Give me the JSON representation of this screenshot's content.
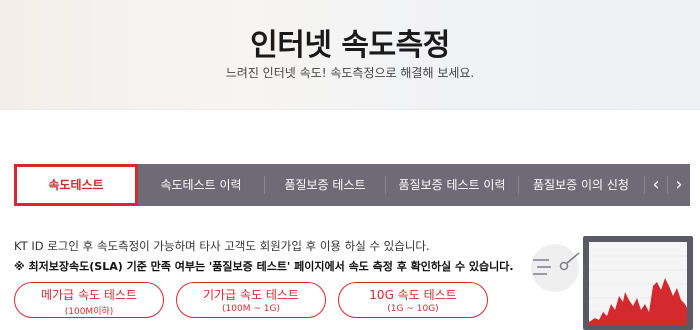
{
  "hero": {
    "title": "인터넷 속도측정",
    "subtitle": "느려진 인터넷 속도! 속도측정으로 해결해 보세요."
  },
  "tabs": [
    {
      "label": "속도테스트",
      "active": true
    },
    {
      "label": "속도테스트 이력",
      "active": false
    },
    {
      "label": "품질보증 테스트",
      "active": false
    },
    {
      "label": "품질보증 테스트 이력",
      "active": false
    },
    {
      "label": "품질보증 이의 신청",
      "active": false
    }
  ],
  "tab_arrows": {
    "prev": "‹",
    "next": "›"
  },
  "notes": {
    "line1": "KT ID 로그인 후 속도측정이 가능하며 타사 고객도 회원가입 후 이용 하실 수 있습니다.",
    "line2": "※ 최저보장속도(SLA) 기준 만족 여부는 '품질보증 테스트' 페이지에서 속도 측정 후 확인하실 수 있습니다."
  },
  "speed_buttons": [
    {
      "label": "메가급 속도 테스트",
      "range": "(100M이하)"
    },
    {
      "label": "기가급 속도 테스트",
      "range": "(100M ~ 1G)"
    },
    {
      "label": "10G 속도 테스트",
      "range": "(1G ~ 10G)"
    }
  ],
  "colors": {
    "accent": "#d42a2f",
    "tabbar": "#6f6b76",
    "monitor": "#5a5a66"
  },
  "icons": {
    "speed_lines": "speed-lines-icon",
    "gauge": "gauge-needle-icon",
    "monitor": "monitor-graph-icon"
  }
}
